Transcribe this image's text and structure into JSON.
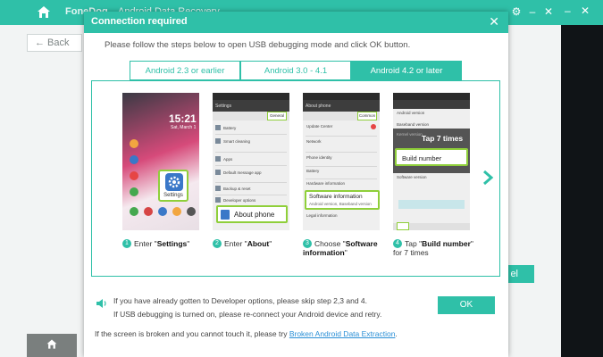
{
  "app": {
    "brand": "FoneDog",
    "title": "Android Data Recovery",
    "back_label": "← Back",
    "right_button_label": "el"
  },
  "modal": {
    "title": "Connection required",
    "close_icon": "close-icon",
    "intro": "Please follow the steps below to open USB debugging mode and click OK button.",
    "tabs": [
      {
        "label": "Android 2.3 or earlier",
        "active": false
      },
      {
        "label": "Android 3.0 - 4.1",
        "active": false
      },
      {
        "label": "Android 4.2 or later",
        "active": true
      }
    ],
    "steps": [
      {
        "num": "1",
        "caption_pre": "Enter \"",
        "caption_bold": "Settings",
        "caption_post": "\"",
        "screen": {
          "time": "15:21",
          "date": "Sat, March 1",
          "highlight_label": "Settings"
        }
      },
      {
        "num": "2",
        "caption_pre": "Enter \"",
        "caption_bold": "About",
        "caption_post": "\"",
        "screen": {
          "header": "Settings",
          "tab": "General",
          "rows": [
            "Battery",
            "Smart cleaning",
            "Apps",
            "Default message app",
            "Backup & reset",
            "Developer options"
          ],
          "highlight_label": "About phone"
        }
      },
      {
        "num": "3",
        "caption_pre": "Choose \"",
        "caption_bold": "Software information",
        "caption_post": "\"",
        "screen": {
          "header": "About phone",
          "tab": "Common",
          "rows": [
            "Update Center",
            "Network",
            "Phone identity",
            "Battery",
            "Hardware information"
          ],
          "highlight_title": "Software information",
          "highlight_sub": "Android version, Baseband version",
          "after_row": "Legal information"
        }
      },
      {
        "num": "4",
        "caption_pre": "Tap \"",
        "caption_bold": "Build number",
        "caption_post": "\" for 7 times",
        "screen": {
          "rows": [
            "Android version",
            "Baseband version",
            "Kernel version"
          ],
          "tap_label": "Tap 7 times",
          "highlight_label": "Build number",
          "after_row": "Software version"
        }
      }
    ],
    "next_icon": "chevron-right-icon",
    "notes": [
      "If you have already gotten to Developer options, please skip step 2,3 and 4.",
      "If USB debugging is turned on, please re-connect your Android device and retry."
    ],
    "ok_label": "OK",
    "footer_text": "If the screen is broken and you cannot touch it, please try ",
    "footer_link": "Broken Android Data Extraction",
    "footer_end": "."
  },
  "colors": {
    "accent": "#2fc0a8",
    "highlight": "#8fcf3a",
    "link": "#2a8fd6"
  }
}
